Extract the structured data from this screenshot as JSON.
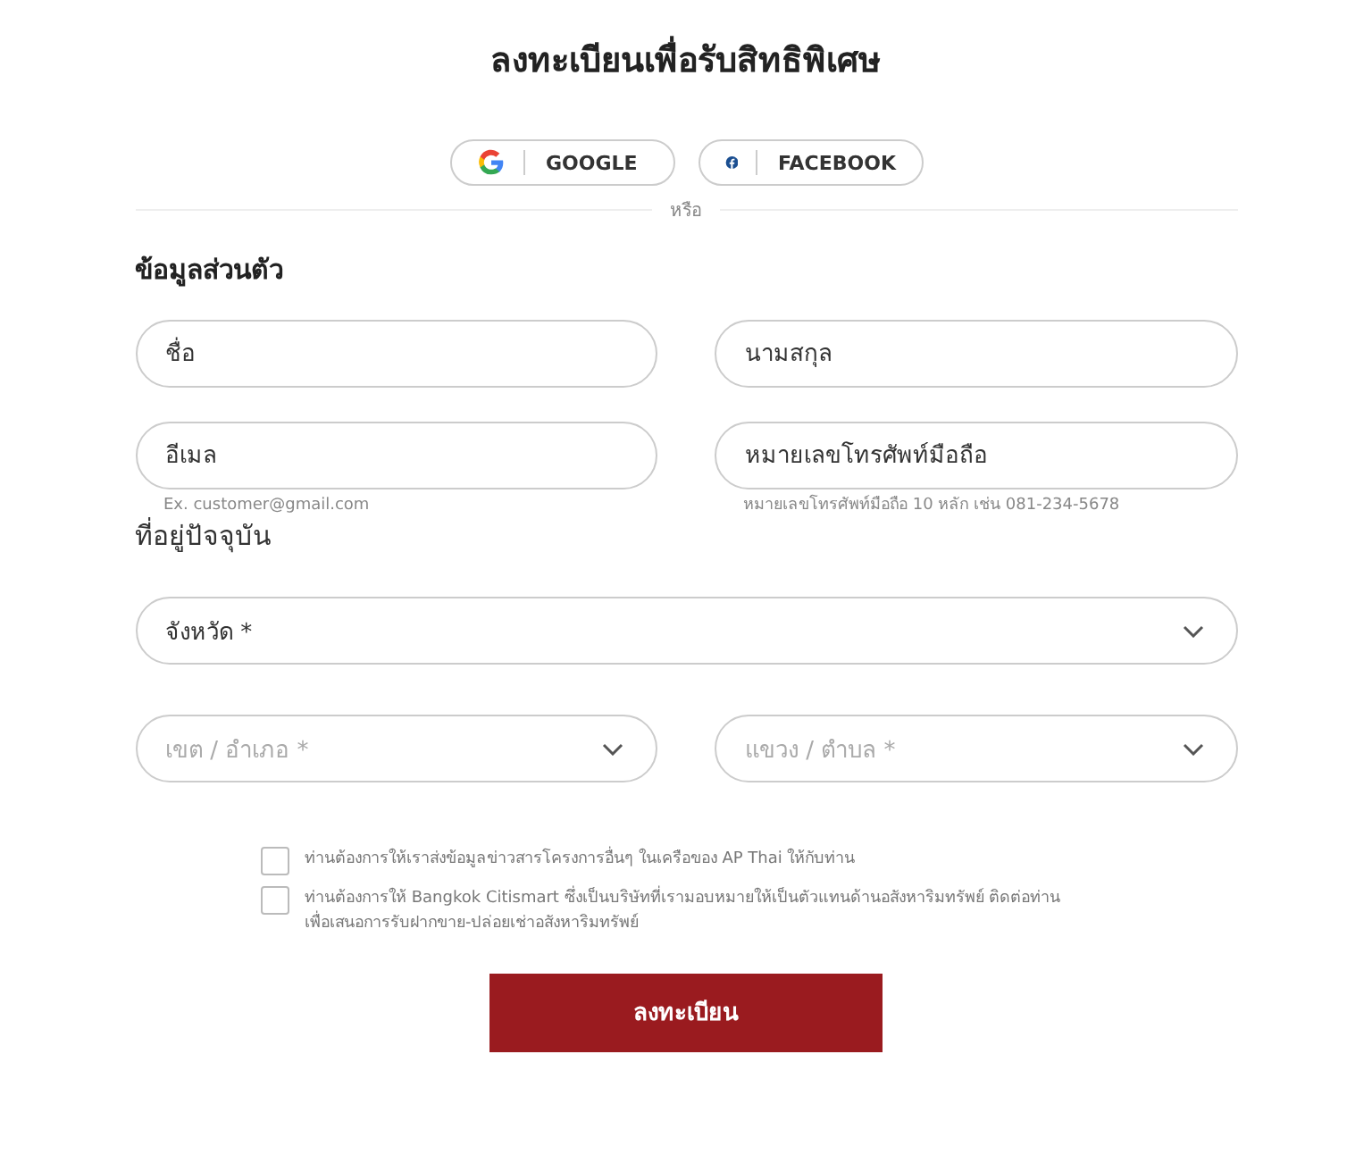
{
  "title": "ลงทะเบียนเพื่อรับสิทธิพิเศษ",
  "social_buttons": [
    {
      "kind": "google",
      "label": "GOOGLE"
    },
    {
      "kind": "facebook",
      "label": "FACEBOOK"
    }
  ],
  "divider_text": "หรือ",
  "personal_section": {
    "heading": "ข้อมูลส่วนตัว",
    "fields": [
      {
        "placeholder": "ชื่อ"
      },
      {
        "placeholder": "นามสกุล"
      },
      {
        "placeholder": "อีเมล",
        "hint": "Ex. customer@gmail.com"
      },
      {
        "placeholder": "หมายเลขโทรศัพท์มือถือ",
        "hint": "หมายเลขโทรศัพท์มือถือ 10 หลัก เช่น 081-234-5678"
      }
    ]
  },
  "address_section": {
    "heading": "ที่อยู่ปัจจุบัน",
    "selects": [
      {
        "placeholder": "จังหวัด *",
        "disabled": false,
        "wide": true
      },
      {
        "placeholder": "เขต / อำเภอ *",
        "disabled": true,
        "wide": false
      },
      {
        "placeholder": "แขวง / ตำบล *",
        "disabled": true,
        "wide": false
      }
    ]
  },
  "consents": [
    {
      "text": "ท่านต้องการให้เราส่งข้อมูลข่าวสารโครงการอื่นๆ ในเครือของ AP Thai ให้กับท่าน",
      "checked": false
    },
    {
      "text": "ท่านต้องการให้ Bangkok Citismart ซึ่งเป็นบริษัทที่เรามอบหมายให้เป็นตัวแทนด้านอสังหาริมทรัพย์ ติดต่อท่านเพื่อเสนอการรับฝากขาย-ปล่อยเช่าอสังหาริมทรัพย์",
      "checked": false
    }
  ],
  "submit_button": "ลงทะเบียน"
}
